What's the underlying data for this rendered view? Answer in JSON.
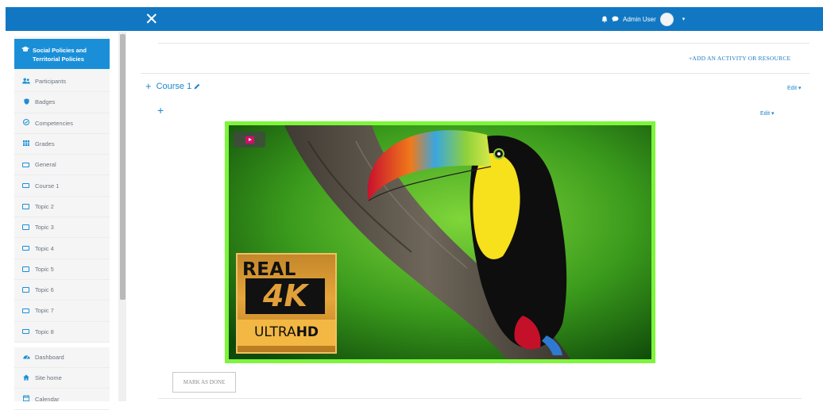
{
  "topbar": {
    "close_label": "✕",
    "user_name": "Admin User",
    "caret": "▾"
  },
  "sidebar": {
    "active": "Social Policies and Territorial Policies",
    "items_top": [
      {
        "label": "Participants",
        "icon": "users-icon"
      },
      {
        "label": "Badges",
        "icon": "shield-icon"
      },
      {
        "label": "Competencies",
        "icon": "check-circle-icon"
      },
      {
        "label": "Grades",
        "icon": "table-icon"
      },
      {
        "label": "General",
        "icon": "folder-icon"
      },
      {
        "label": "Course 1",
        "icon": "folder-icon"
      },
      {
        "label": "Topic 2",
        "icon": "folder-icon"
      },
      {
        "label": "Topic 3",
        "icon": "folder-icon"
      },
      {
        "label": "Topic 4",
        "icon": "folder-icon"
      },
      {
        "label": "Topic 5",
        "icon": "folder-icon"
      },
      {
        "label": "Topic 6",
        "icon": "folder-icon"
      },
      {
        "label": "Topic 7",
        "icon": "folder-icon"
      },
      {
        "label": "Topic 8",
        "icon": "folder-icon"
      }
    ],
    "items_bottom": [
      {
        "label": "Dashboard",
        "icon": "dashboard-icon"
      },
      {
        "label": "Site home",
        "icon": "home-icon"
      },
      {
        "label": "Calendar",
        "icon": "calendar-icon"
      }
    ]
  },
  "main": {
    "add_activity": "+ADD AN ACTIVITY OR RESOURCE",
    "section_title": "Course 1",
    "edit_label": "Edit ▾",
    "mark_done": "MARK AS DONE",
    "video_badge": {
      "real": "REAL",
      "fourk": "4K",
      "ultra": "ULTRA",
      "hd": "HD"
    }
  },
  "colors": {
    "topbar": "#1177c2",
    "active_item": "#1a8fd8",
    "link": "#1a86d0",
    "video_border": "#7cf53a"
  }
}
